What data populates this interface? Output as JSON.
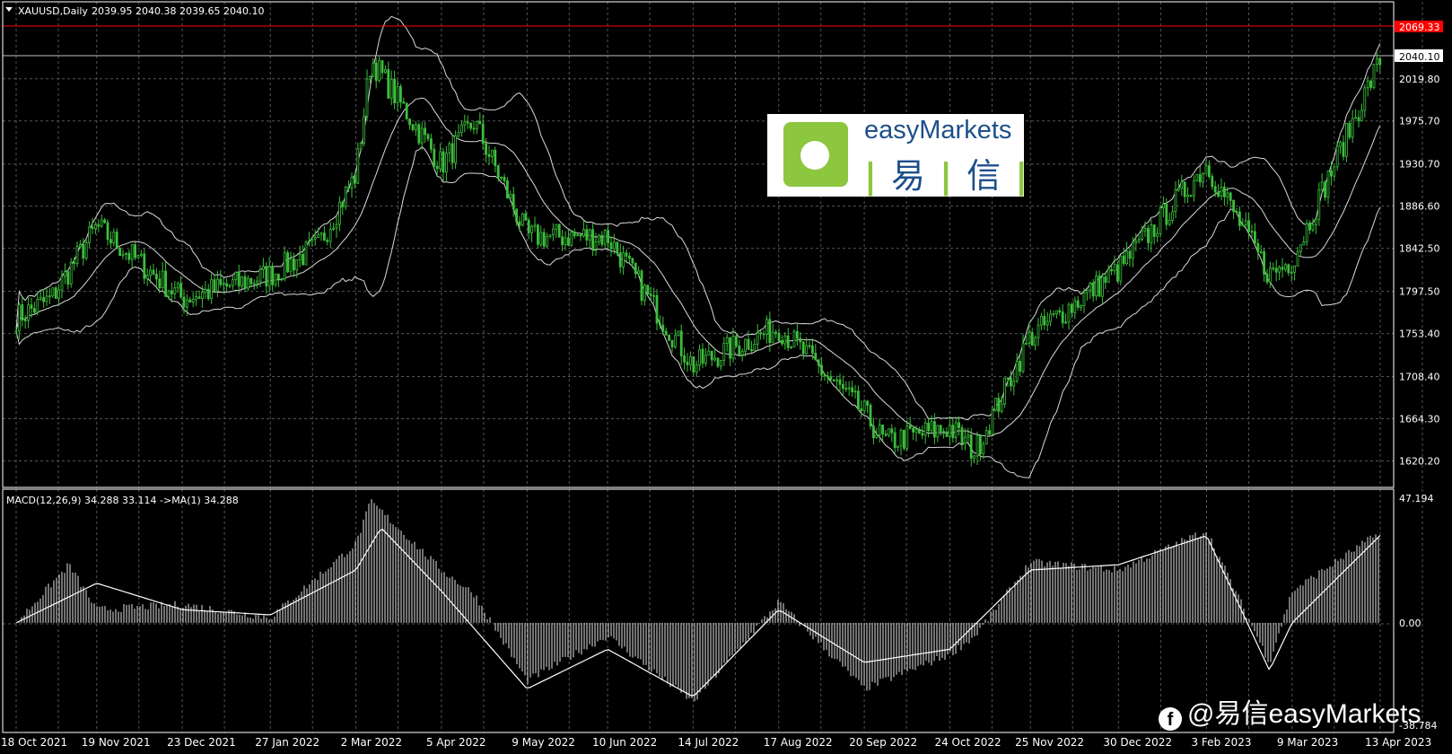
{
  "chart_data": [
    {
      "type": "candlestick",
      "title": "XAUUSD,Daily",
      "ohlc_readout": "2039.95 2040.38 2039.65 2040.10",
      "y_ticks": [
        "2019.80",
        "1975.70",
        "1930.70",
        "1886.60",
        "1842.50",
        "1797.50",
        "1753.40",
        "1708.40",
        "1664.30",
        "1620.20"
      ],
      "ylim": [
        1600,
        2075
      ],
      "x_ticks": [
        "18 Oct 2021",
        "19 Nov 2021",
        "23 Dec 2021",
        "27 Jan 2022",
        "2 Mar 2022",
        "5 Apr 2022",
        "9 May 2022",
        "10 Jun 2022",
        "14 Jul 2022",
        "17 Aug 2022",
        "20 Sep 2022",
        "24 Oct 2022",
        "25 Nov 2022",
        "30 Dec 2022",
        "3 Feb 2023",
        "9 Mar 2023",
        "13 Apr 2023"
      ],
      "current_price_label": "2040.10",
      "alert_level_label": "2069.33",
      "close_series": {
        "dates": [
          "18 Oct 2021",
          "1 Nov 2021",
          "19 Nov 2021",
          "23 Dec 2021",
          "27 Jan 2022",
          "15 Feb 2022",
          "2 Mar 2022",
          "8 Mar 2022",
          "5 Apr 2022",
          "18 Apr 2022",
          "9 May 2022",
          "10 Jun 2022",
          "14 Jul 2022",
          "17 Aug 2022",
          "20 Sep 2022",
          "28 Sep 2022",
          "24 Oct 2022",
          "3 Nov 2022",
          "25 Nov 2022",
          "30 Dec 2022",
          "3 Feb 2023",
          "28 Feb 2023",
          "9 Mar 2023",
          "13 Apr 2023"
        ],
        "values": [
          1770,
          1790,
          1865,
          1790,
          1815,
          1845,
          1920,
          2040,
          1930,
          1975,
          1855,
          1855,
          1720,
          1760,
          1670,
          1640,
          1655,
          1630,
          1750,
          1820,
          1930,
          1815,
          1830,
          2040
        ]
      },
      "bollinger_bands": "upper, middle, lower bands"
    },
    {
      "type": "bar",
      "title": "MACD(12,26,9) 34.288 33.114 ->MA(1) 34.288",
      "y_ticks": [
        "47.194",
        "0.00",
        "-38.784"
      ],
      "ylim": [
        -38.784,
        47.194
      ],
      "histogram": {
        "dates": [
          "18 Oct 2021",
          "8 Nov 2021",
          "19 Nov 2021",
          "23 Dec 2021",
          "27 Jan 2022",
          "2 Mar 2022",
          "8 Mar 2022",
          "5 Apr 2022",
          "18 Apr 2022",
          "9 May 2022",
          "10 Jun 2022",
          "14 Jul 2022",
          "17 Aug 2022",
          "20 Sep 2022",
          "24 Oct 2022",
          "3 Nov 2022",
          "25 Nov 2022",
          "30 Dec 2022",
          "3 Feb 2023",
          "28 Feb 2023",
          "9 Mar 2023",
          "13 Apr 2023"
        ],
        "values": [
          0,
          22,
          5,
          7,
          2,
          30,
          46,
          20,
          11,
          -22,
          -5,
          -30,
          8,
          -25,
          -12,
          -5,
          23,
          20,
          35,
          -15,
          12,
          34.288
        ]
      },
      "signal_line": {
        "dates": [
          "18 Oct 2021",
          "19 Nov 2021",
          "23 Dec 2021",
          "27 Jan 2022",
          "2 Mar 2022",
          "12 Mar 2022",
          "5 Apr 2022",
          "9 May 2022",
          "10 Jun 2022",
          "14 Jul 2022",
          "17 Aug 2022",
          "20 Sep 2022",
          "24 Oct 2022",
          "25 Nov 2022",
          "30 Dec 2022",
          "3 Feb 2023",
          "28 Feb 2023",
          "9 Mar 2023",
          "13 Apr 2023"
        ],
        "values": [
          0,
          15,
          5,
          3,
          20,
          36,
          12,
          -25,
          -10,
          -28,
          5,
          -15,
          -10,
          20,
          22,
          33,
          -18,
          0,
          33.114
        ]
      }
    }
  ],
  "logo": {
    "brand": "easyMarkets",
    "cn_1": "易",
    "cn_2": "信",
    "divider": "|"
  },
  "watermark": {
    "icon": "facebook-icon",
    "text": "@易信easyMarkets"
  },
  "colors": {
    "candles": "#3cbf3c",
    "bands": "#d9d9d9",
    "grid": "#555555",
    "alert_line": "#ff0000",
    "logo_accent": "#8dc63f",
    "logo_text": "#1d4f8a"
  }
}
